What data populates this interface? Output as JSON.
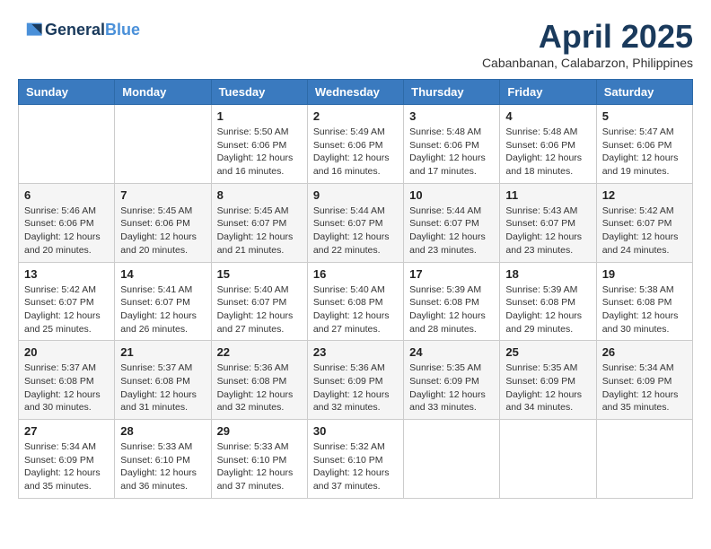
{
  "header": {
    "logo_line1": "General",
    "logo_line2": "Blue",
    "month_year": "April 2025",
    "location": "Cabanbanan, Calabarzon, Philippines"
  },
  "days_of_week": [
    "Sunday",
    "Monday",
    "Tuesday",
    "Wednesday",
    "Thursday",
    "Friday",
    "Saturday"
  ],
  "weeks": [
    [
      {
        "day": "",
        "content": ""
      },
      {
        "day": "",
        "content": ""
      },
      {
        "day": "1",
        "content": "Sunrise: 5:50 AM\nSunset: 6:06 PM\nDaylight: 12 hours and 16 minutes."
      },
      {
        "day": "2",
        "content": "Sunrise: 5:49 AM\nSunset: 6:06 PM\nDaylight: 12 hours and 16 minutes."
      },
      {
        "day": "3",
        "content": "Sunrise: 5:48 AM\nSunset: 6:06 PM\nDaylight: 12 hours and 17 minutes."
      },
      {
        "day": "4",
        "content": "Sunrise: 5:48 AM\nSunset: 6:06 PM\nDaylight: 12 hours and 18 minutes."
      },
      {
        "day": "5",
        "content": "Sunrise: 5:47 AM\nSunset: 6:06 PM\nDaylight: 12 hours and 19 minutes."
      }
    ],
    [
      {
        "day": "6",
        "content": "Sunrise: 5:46 AM\nSunset: 6:06 PM\nDaylight: 12 hours and 20 minutes."
      },
      {
        "day": "7",
        "content": "Sunrise: 5:45 AM\nSunset: 6:06 PM\nDaylight: 12 hours and 20 minutes."
      },
      {
        "day": "8",
        "content": "Sunrise: 5:45 AM\nSunset: 6:07 PM\nDaylight: 12 hours and 21 minutes."
      },
      {
        "day": "9",
        "content": "Sunrise: 5:44 AM\nSunset: 6:07 PM\nDaylight: 12 hours and 22 minutes."
      },
      {
        "day": "10",
        "content": "Sunrise: 5:44 AM\nSunset: 6:07 PM\nDaylight: 12 hours and 23 minutes."
      },
      {
        "day": "11",
        "content": "Sunrise: 5:43 AM\nSunset: 6:07 PM\nDaylight: 12 hours and 23 minutes."
      },
      {
        "day": "12",
        "content": "Sunrise: 5:42 AM\nSunset: 6:07 PM\nDaylight: 12 hours and 24 minutes."
      }
    ],
    [
      {
        "day": "13",
        "content": "Sunrise: 5:42 AM\nSunset: 6:07 PM\nDaylight: 12 hours and 25 minutes."
      },
      {
        "day": "14",
        "content": "Sunrise: 5:41 AM\nSunset: 6:07 PM\nDaylight: 12 hours and 26 minutes."
      },
      {
        "day": "15",
        "content": "Sunrise: 5:40 AM\nSunset: 6:07 PM\nDaylight: 12 hours and 27 minutes."
      },
      {
        "day": "16",
        "content": "Sunrise: 5:40 AM\nSunset: 6:08 PM\nDaylight: 12 hours and 27 minutes."
      },
      {
        "day": "17",
        "content": "Sunrise: 5:39 AM\nSunset: 6:08 PM\nDaylight: 12 hours and 28 minutes."
      },
      {
        "day": "18",
        "content": "Sunrise: 5:39 AM\nSunset: 6:08 PM\nDaylight: 12 hours and 29 minutes."
      },
      {
        "day": "19",
        "content": "Sunrise: 5:38 AM\nSunset: 6:08 PM\nDaylight: 12 hours and 30 minutes."
      }
    ],
    [
      {
        "day": "20",
        "content": "Sunrise: 5:37 AM\nSunset: 6:08 PM\nDaylight: 12 hours and 30 minutes."
      },
      {
        "day": "21",
        "content": "Sunrise: 5:37 AM\nSunset: 6:08 PM\nDaylight: 12 hours and 31 minutes."
      },
      {
        "day": "22",
        "content": "Sunrise: 5:36 AM\nSunset: 6:08 PM\nDaylight: 12 hours and 32 minutes."
      },
      {
        "day": "23",
        "content": "Sunrise: 5:36 AM\nSunset: 6:09 PM\nDaylight: 12 hours and 32 minutes."
      },
      {
        "day": "24",
        "content": "Sunrise: 5:35 AM\nSunset: 6:09 PM\nDaylight: 12 hours and 33 minutes."
      },
      {
        "day": "25",
        "content": "Sunrise: 5:35 AM\nSunset: 6:09 PM\nDaylight: 12 hours and 34 minutes."
      },
      {
        "day": "26",
        "content": "Sunrise: 5:34 AM\nSunset: 6:09 PM\nDaylight: 12 hours and 35 minutes."
      }
    ],
    [
      {
        "day": "27",
        "content": "Sunrise: 5:34 AM\nSunset: 6:09 PM\nDaylight: 12 hours and 35 minutes."
      },
      {
        "day": "28",
        "content": "Sunrise: 5:33 AM\nSunset: 6:10 PM\nDaylight: 12 hours and 36 minutes."
      },
      {
        "day": "29",
        "content": "Sunrise: 5:33 AM\nSunset: 6:10 PM\nDaylight: 12 hours and 37 minutes."
      },
      {
        "day": "30",
        "content": "Sunrise: 5:32 AM\nSunset: 6:10 PM\nDaylight: 12 hours and 37 minutes."
      },
      {
        "day": "",
        "content": ""
      },
      {
        "day": "",
        "content": ""
      },
      {
        "day": "",
        "content": ""
      }
    ]
  ]
}
